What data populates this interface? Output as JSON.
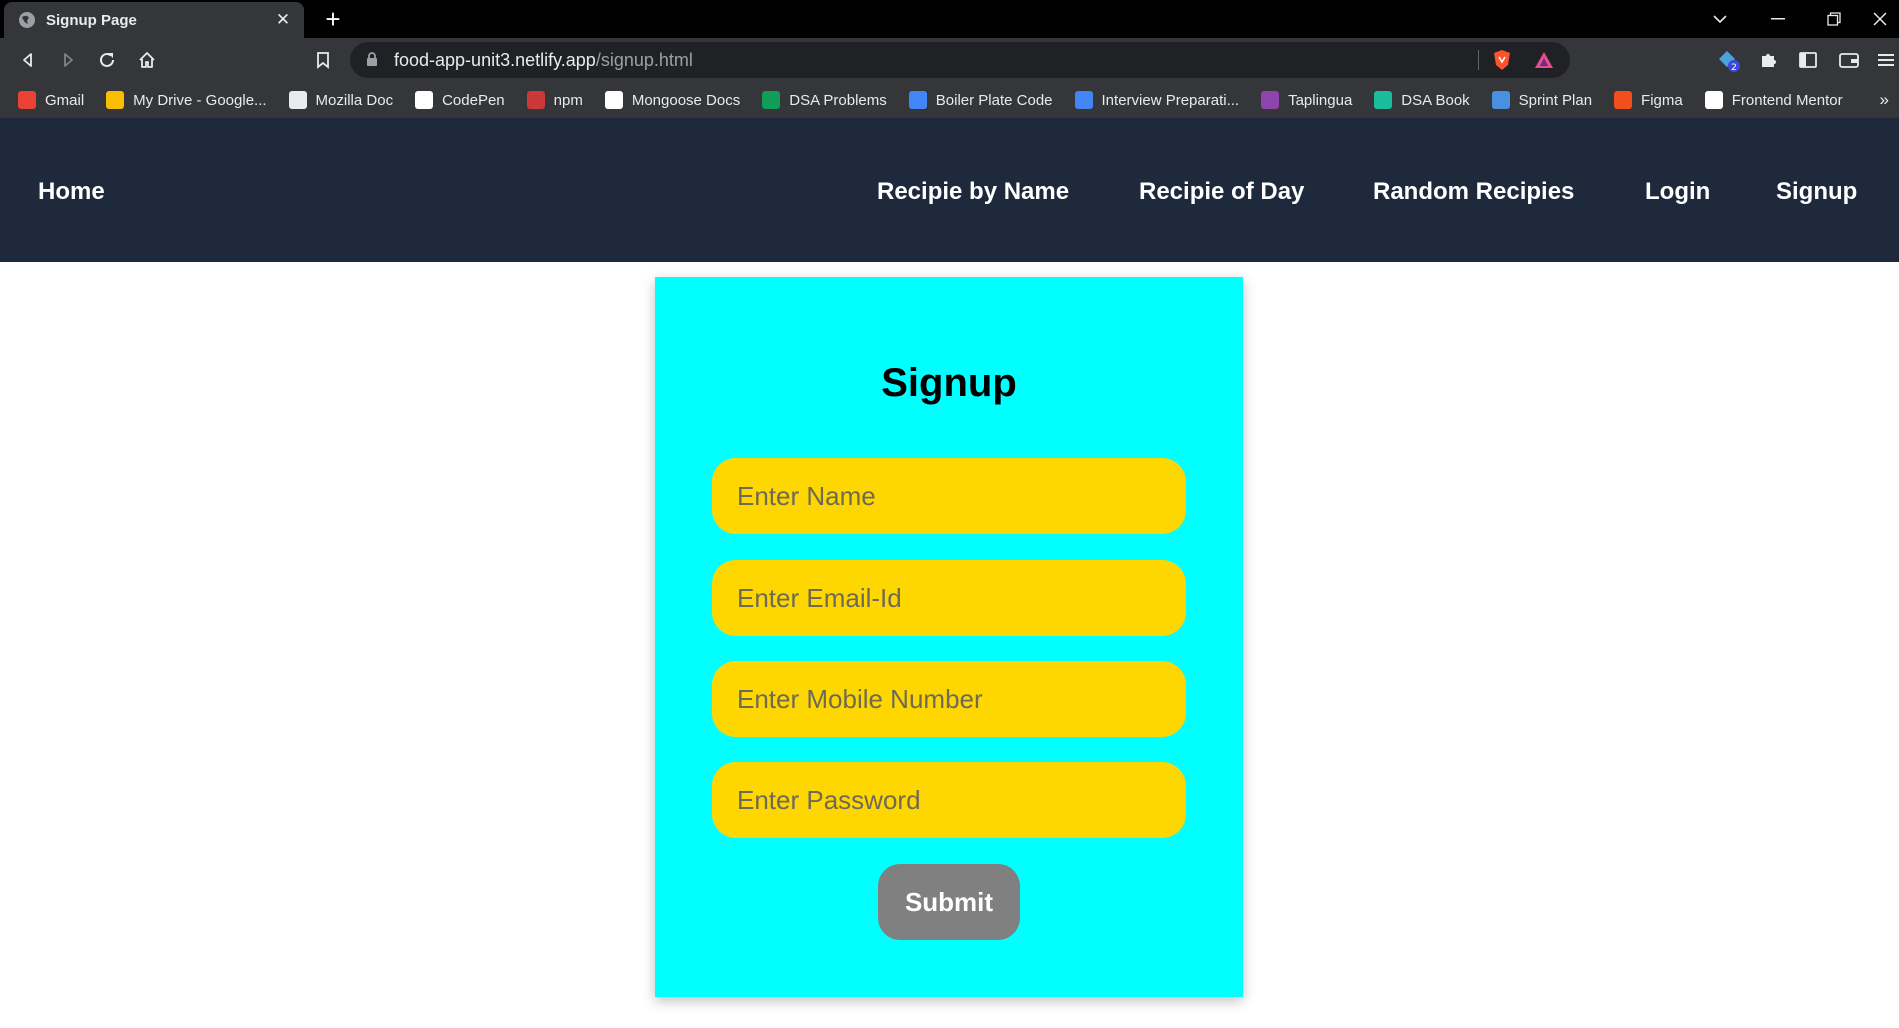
{
  "browser": {
    "tab_title": "Signup Page",
    "url_host": "food-app-unit3.netlify.app",
    "url_path": "/signup.html",
    "extension_badge": "2",
    "bookmarks": [
      {
        "label": "Gmail",
        "icon": "gmail-icon",
        "color": "#ea4335"
      },
      {
        "label": "My Drive - Google...",
        "icon": "google-drive-icon",
        "color": "#fbbc04"
      },
      {
        "label": "Mozilla Doc",
        "icon": "mdn-icon",
        "color": "#e8eaed"
      },
      {
        "label": "CodePen",
        "icon": "codepen-icon",
        "color": "#ffffff"
      },
      {
        "label": "npm",
        "icon": "npm-icon",
        "color": "#cb3837"
      },
      {
        "label": "Mongoose Docs",
        "icon": "mongoose-icon",
        "color": "#ffffff"
      },
      {
        "label": "DSA Problems",
        "icon": "google-sheets-icon",
        "color": "#0f9d58"
      },
      {
        "label": "Boiler Plate Code",
        "icon": "google-docs-icon",
        "color": "#4285f4"
      },
      {
        "label": "Interview Preparati...",
        "icon": "google-docs-icon",
        "color": "#4285f4"
      },
      {
        "label": "Taplingua",
        "icon": "star-icon",
        "color": "#8e44ad"
      },
      {
        "label": "DSA Book",
        "icon": "book-icon",
        "color": "#1abc9c"
      },
      {
        "label": "Sprint Plan",
        "icon": "plan-icon",
        "color": "#4a90e2"
      },
      {
        "label": "Figma",
        "icon": "figma-icon",
        "color": "#f24e1e"
      },
      {
        "label": "Frontend Mentor",
        "icon": "frontend-mentor-icon",
        "color": "#ffffff"
      }
    ],
    "more_bookmarks": "»"
  },
  "navbar": {
    "home": "Home",
    "links": [
      "Recipie by Name",
      "Recipie of Day",
      "Random Recipies",
      "Login",
      "Signup"
    ]
  },
  "form": {
    "title": "Signup",
    "name_placeholder": "Enter Name",
    "email_placeholder": "Enter Email-Id",
    "mobile_placeholder": "Enter Mobile Number",
    "password_placeholder": "Enter Password",
    "submit_label": "Submit"
  },
  "colors": {
    "navbar_bg": "#1e293b",
    "card_bg": "#00ffff",
    "input_bg": "#ffd700",
    "submit_bg": "#808080"
  }
}
